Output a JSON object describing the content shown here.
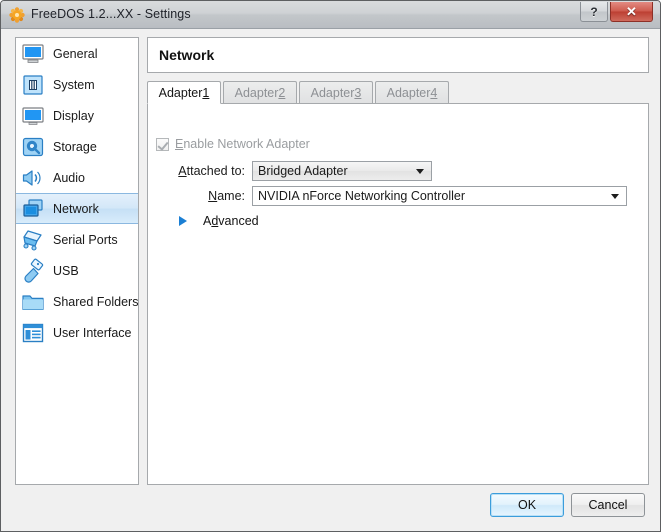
{
  "window": {
    "title": "FreeDOS 1.2...XX - Settings",
    "app_icon": "virtualbox-freedos-icon",
    "help_button_label": "?",
    "close_button_label": "✕"
  },
  "sidebar": {
    "items": [
      {
        "label": "General",
        "icon": "monitor-general-icon",
        "selected": false
      },
      {
        "label": "System",
        "icon": "chip-system-icon",
        "selected": false
      },
      {
        "label": "Display",
        "icon": "monitor-display-icon",
        "selected": false
      },
      {
        "label": "Storage",
        "icon": "harddisk-storage-icon",
        "selected": false
      },
      {
        "label": "Audio",
        "icon": "speaker-audio-icon",
        "selected": false
      },
      {
        "label": "Network",
        "icon": "network-cards-icon",
        "selected": true
      },
      {
        "label": "Serial Ports",
        "icon": "serial-port-plug-icon",
        "selected": false
      },
      {
        "label": "USB",
        "icon": "usb-plug-icon",
        "selected": false
      },
      {
        "label": "Shared Folders",
        "icon": "folder-shared-icon",
        "selected": false
      },
      {
        "label": "User Interface",
        "icon": "window-ui-icon",
        "selected": false
      }
    ]
  },
  "main": {
    "page_title": "Network",
    "tabs": [
      {
        "label": "Adapter ",
        "mnemonic": "1",
        "active": true
      },
      {
        "label": "Adapter ",
        "mnemonic": "2",
        "active": false
      },
      {
        "label": "Adapter ",
        "mnemonic": "3",
        "active": false
      },
      {
        "label": "Adapter ",
        "mnemonic": "4",
        "active": false
      }
    ],
    "enable_adapter": {
      "label_before": "",
      "mnemonic": "E",
      "label_after": "nable Network Adapter",
      "checked": true,
      "enabled": false
    },
    "attached_to": {
      "label_mnemonic": "A",
      "label_after": "ttached to:",
      "value": "Bridged Adapter"
    },
    "adapter_name": {
      "label_mnemonic": "N",
      "label_after": "ame:",
      "value": "NVIDIA nForce Networking Controller"
    },
    "advanced": {
      "label_before": "A",
      "mnemonic": "d",
      "label_after": "vanced",
      "expanded": false,
      "triangle_color": "#1b7fd4"
    }
  },
  "footer": {
    "ok_label": "OK",
    "cancel_label": "Cancel"
  },
  "colors": {
    "selection_blue": "#c5dff5",
    "accent_blue": "#1b7fd4",
    "close_red": "#bc3f32",
    "window_bg": "#f0f0f0"
  }
}
